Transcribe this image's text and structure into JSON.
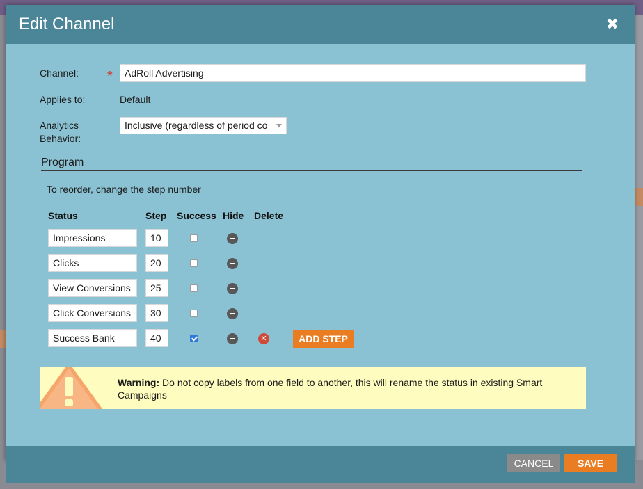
{
  "modal": {
    "title": "Edit Channel",
    "close_glyph": "✖"
  },
  "form": {
    "channel_label": "Channel:",
    "channel_value": "AdRoll Advertising",
    "required_mark": "*",
    "applies_to_label": "Applies to:",
    "applies_to_value": "Default",
    "analytics_label_line1": "Analytics",
    "analytics_label_line2": "Behavior:",
    "analytics_value": "Inclusive (regardless of period co"
  },
  "program": {
    "section_title": "Program",
    "hint": "To reorder, change the step number",
    "columns": {
      "status": "Status",
      "step": "Step",
      "success": "Success",
      "hide": "Hide",
      "delete": "Delete"
    },
    "rows": [
      {
        "status": "Impressions",
        "step": "10",
        "success": false,
        "deletable": false
      },
      {
        "status": "Clicks",
        "step": "20",
        "success": false,
        "deletable": false
      },
      {
        "status": "View Conversions",
        "step": "25",
        "success": false,
        "deletable": false
      },
      {
        "status": "Click Conversions",
        "step": "30",
        "success": false,
        "deletable": false
      },
      {
        "status": "Success Bank",
        "step": "40",
        "success": true,
        "deletable": true
      }
    ],
    "add_step_label": "ADD STEP"
  },
  "warning": {
    "bold": "Warning:",
    "text": " Do not copy labels from one field to another, this will rename the status in existing Smart Campaigns"
  },
  "footer": {
    "cancel_label": "CANCEL",
    "save_label": "SAVE"
  },
  "colors": {
    "header": "#4b8598",
    "body": "#8bc2d3",
    "accent": "#ea7d22",
    "warning_bg": "#fefcbe"
  }
}
